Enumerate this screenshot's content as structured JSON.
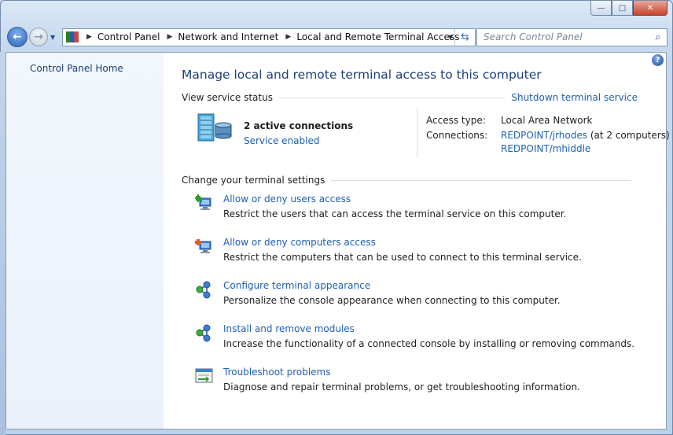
{
  "window": {
    "caption": {
      "minimize": "—",
      "maximize": "□",
      "close": "✕"
    }
  },
  "nav": {
    "back_icon": "arrow-left-icon",
    "forward_icon": "arrow-right-icon",
    "breadcrumbs": [
      "Control Panel",
      "Network and Internet",
      "Local and Remote Terminal Access"
    ],
    "search_placeholder": "Search Control Panel"
  },
  "sidebar": {
    "home_link": "Control Panel Home"
  },
  "main": {
    "title": "Manage local and remote terminal access to this computer",
    "view_status_label": "View service status",
    "shutdown_link": "Shutdown terminal service",
    "status": {
      "connections_count": "2 active connections",
      "service_state": "Service enabled",
      "access_type_label": "Access type:",
      "access_type_value": "Local Area Network",
      "connections_label": "Connections:",
      "connection_1": "REDPOINT/jrhodes",
      "connection_1_note": "(at 2 computers)",
      "connection_2": "REDPOINT/mhiddle"
    },
    "settings_label": "Change your terminal settings",
    "tasks": [
      {
        "title": "Allow or deny users access",
        "desc": "Restrict the users that can access the terminal service on this computer.",
        "icon": "users-access-icon"
      },
      {
        "title": "Allow or deny computers access",
        "desc": "Restrict the computers that can be used to connect to this terminal service.",
        "icon": "computers-access-icon"
      },
      {
        "title": "Configure terminal appearance",
        "desc": "Personalize the console appearance when connecting to this computer.",
        "icon": "network-nodes-icon"
      },
      {
        "title": "Install and remove modules",
        "desc": "Increase the functionality of a connected console by installing or removing commands.",
        "icon": "network-nodes-icon"
      },
      {
        "title": "Troubleshoot problems",
        "desc": "Diagnose and repair terminal problems, or get troubleshooting information.",
        "icon": "troubleshoot-icon"
      }
    ]
  },
  "colors": {
    "link": "#1e5fb7",
    "title": "#1e3f78",
    "sidebar_bg": "#eef4fb"
  }
}
